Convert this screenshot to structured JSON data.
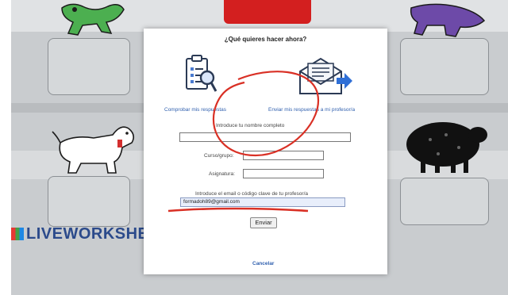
{
  "brand": {
    "logo_text": "LIVEWORKSHE"
  },
  "modal": {
    "title": "¿Qué quieres hacer ahora?",
    "option_check": {
      "label": "Comprobar mis respuestas",
      "icon": "clipboard-magnifier-icon"
    },
    "option_send": {
      "label": "Enviar mis respuestas a mi profesor/a",
      "icon": "envelope-send-icon"
    },
    "fields": {
      "name": {
        "label": "Introduce tu nombre completo",
        "value": ""
      },
      "course": {
        "label": "Curso/grupo:",
        "value": ""
      },
      "subject": {
        "label": "Asignatura:",
        "value": ""
      },
      "email": {
        "label": "Introduce el email o código clave de tu profesor/a",
        "value": "formadoh89@gmail.com"
      }
    },
    "send_button": "Enviar",
    "cancel_link": "Cancelar"
  },
  "colors": {
    "link_blue": "#2f5fae",
    "annotation_red": "#d93025",
    "email_field_bg": "#e8eefb"
  }
}
